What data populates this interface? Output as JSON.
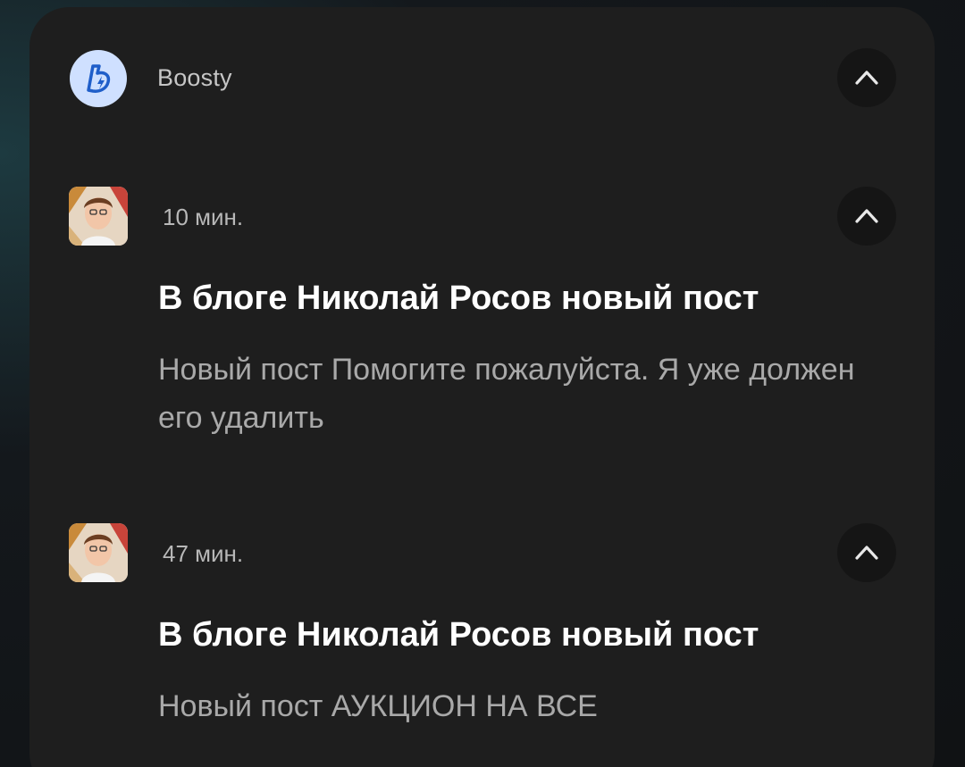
{
  "app": {
    "name": "Boosty",
    "icon": "boosty-logo-icon",
    "icon_bg": "#cfe0ff",
    "icon_fg": "#1f5ec9"
  },
  "notifications": [
    {
      "time": "10 мин.",
      "title": "В блоге Николай Росов новый пост",
      "text": "Новый пост Помогите пожалуйста. Я уже должен его удалить",
      "avatar": "author-avatar"
    },
    {
      "time": "47 мин.",
      "title": "В блоге Николай Росов новый пост",
      "text": "Новый пост АУКЦИОН НА ВСЕ",
      "avatar": "author-avatar"
    }
  ],
  "colors": {
    "card_bg": "#1e1e1e",
    "button_bg": "#151515",
    "title": "#ffffff",
    "body": "#a9a9a9"
  }
}
